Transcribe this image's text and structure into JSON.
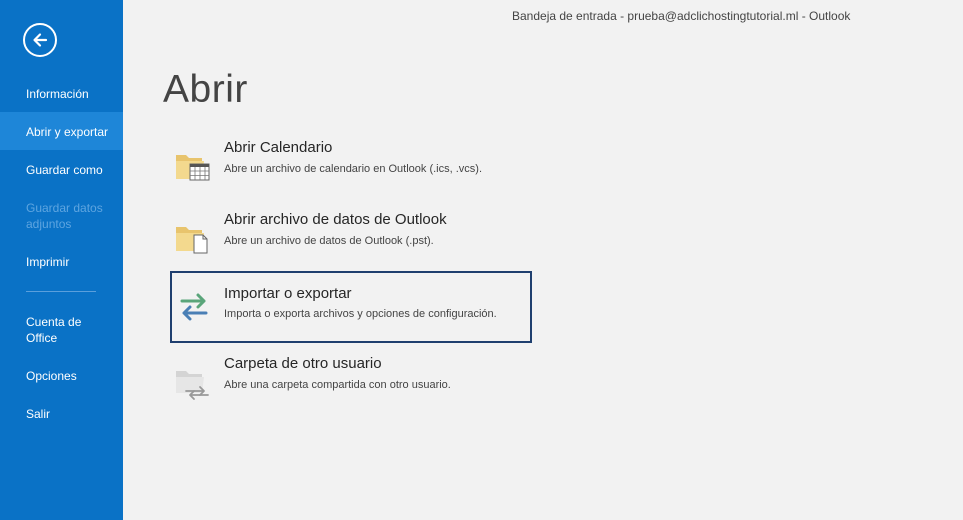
{
  "window": {
    "title": "Bandeja de entrada - prueba@adclichostingtutorial.ml - Outlook"
  },
  "sidebar": {
    "back_icon": "back-arrow-icon",
    "items": [
      {
        "label": "Información",
        "state": "normal"
      },
      {
        "label": "Abrir y exportar",
        "state": "active"
      },
      {
        "label": "Guardar como",
        "state": "normal"
      },
      {
        "label": "Guardar datos adjuntos",
        "state": "disabled"
      },
      {
        "label": "Imprimir",
        "state": "normal"
      },
      {
        "label": "Cuenta de Office",
        "state": "normal"
      },
      {
        "label": "Opciones",
        "state": "normal"
      },
      {
        "label": "Salir",
        "state": "normal"
      }
    ]
  },
  "main": {
    "title": "Abrir",
    "options": [
      {
        "label": "Abrir Calendario",
        "description": "Abre un archivo de calendario en Outlook (.ics, .vcs).",
        "icon": "folder-calendar-icon"
      },
      {
        "label": "Abrir archivo de datos de Outlook",
        "description": "Abre un archivo de datos de Outlook (.pst).",
        "icon": "folder-file-icon"
      },
      {
        "label": "Importar o exportar",
        "description": "Importa o exporta archivos y opciones de configuración.",
        "icon": "import-export-arrows-icon",
        "selected": true
      },
      {
        "label": "Carpeta de otro usuario",
        "description": "Abre una carpeta compartida con otro usuario.",
        "icon": "shared-folder-icon"
      }
    ]
  },
  "colors": {
    "sidebar": "#0a72c6",
    "sidebar_active": "#1e86d8",
    "background": "#f2f2f2",
    "selection_border": "#1f3f6f"
  }
}
